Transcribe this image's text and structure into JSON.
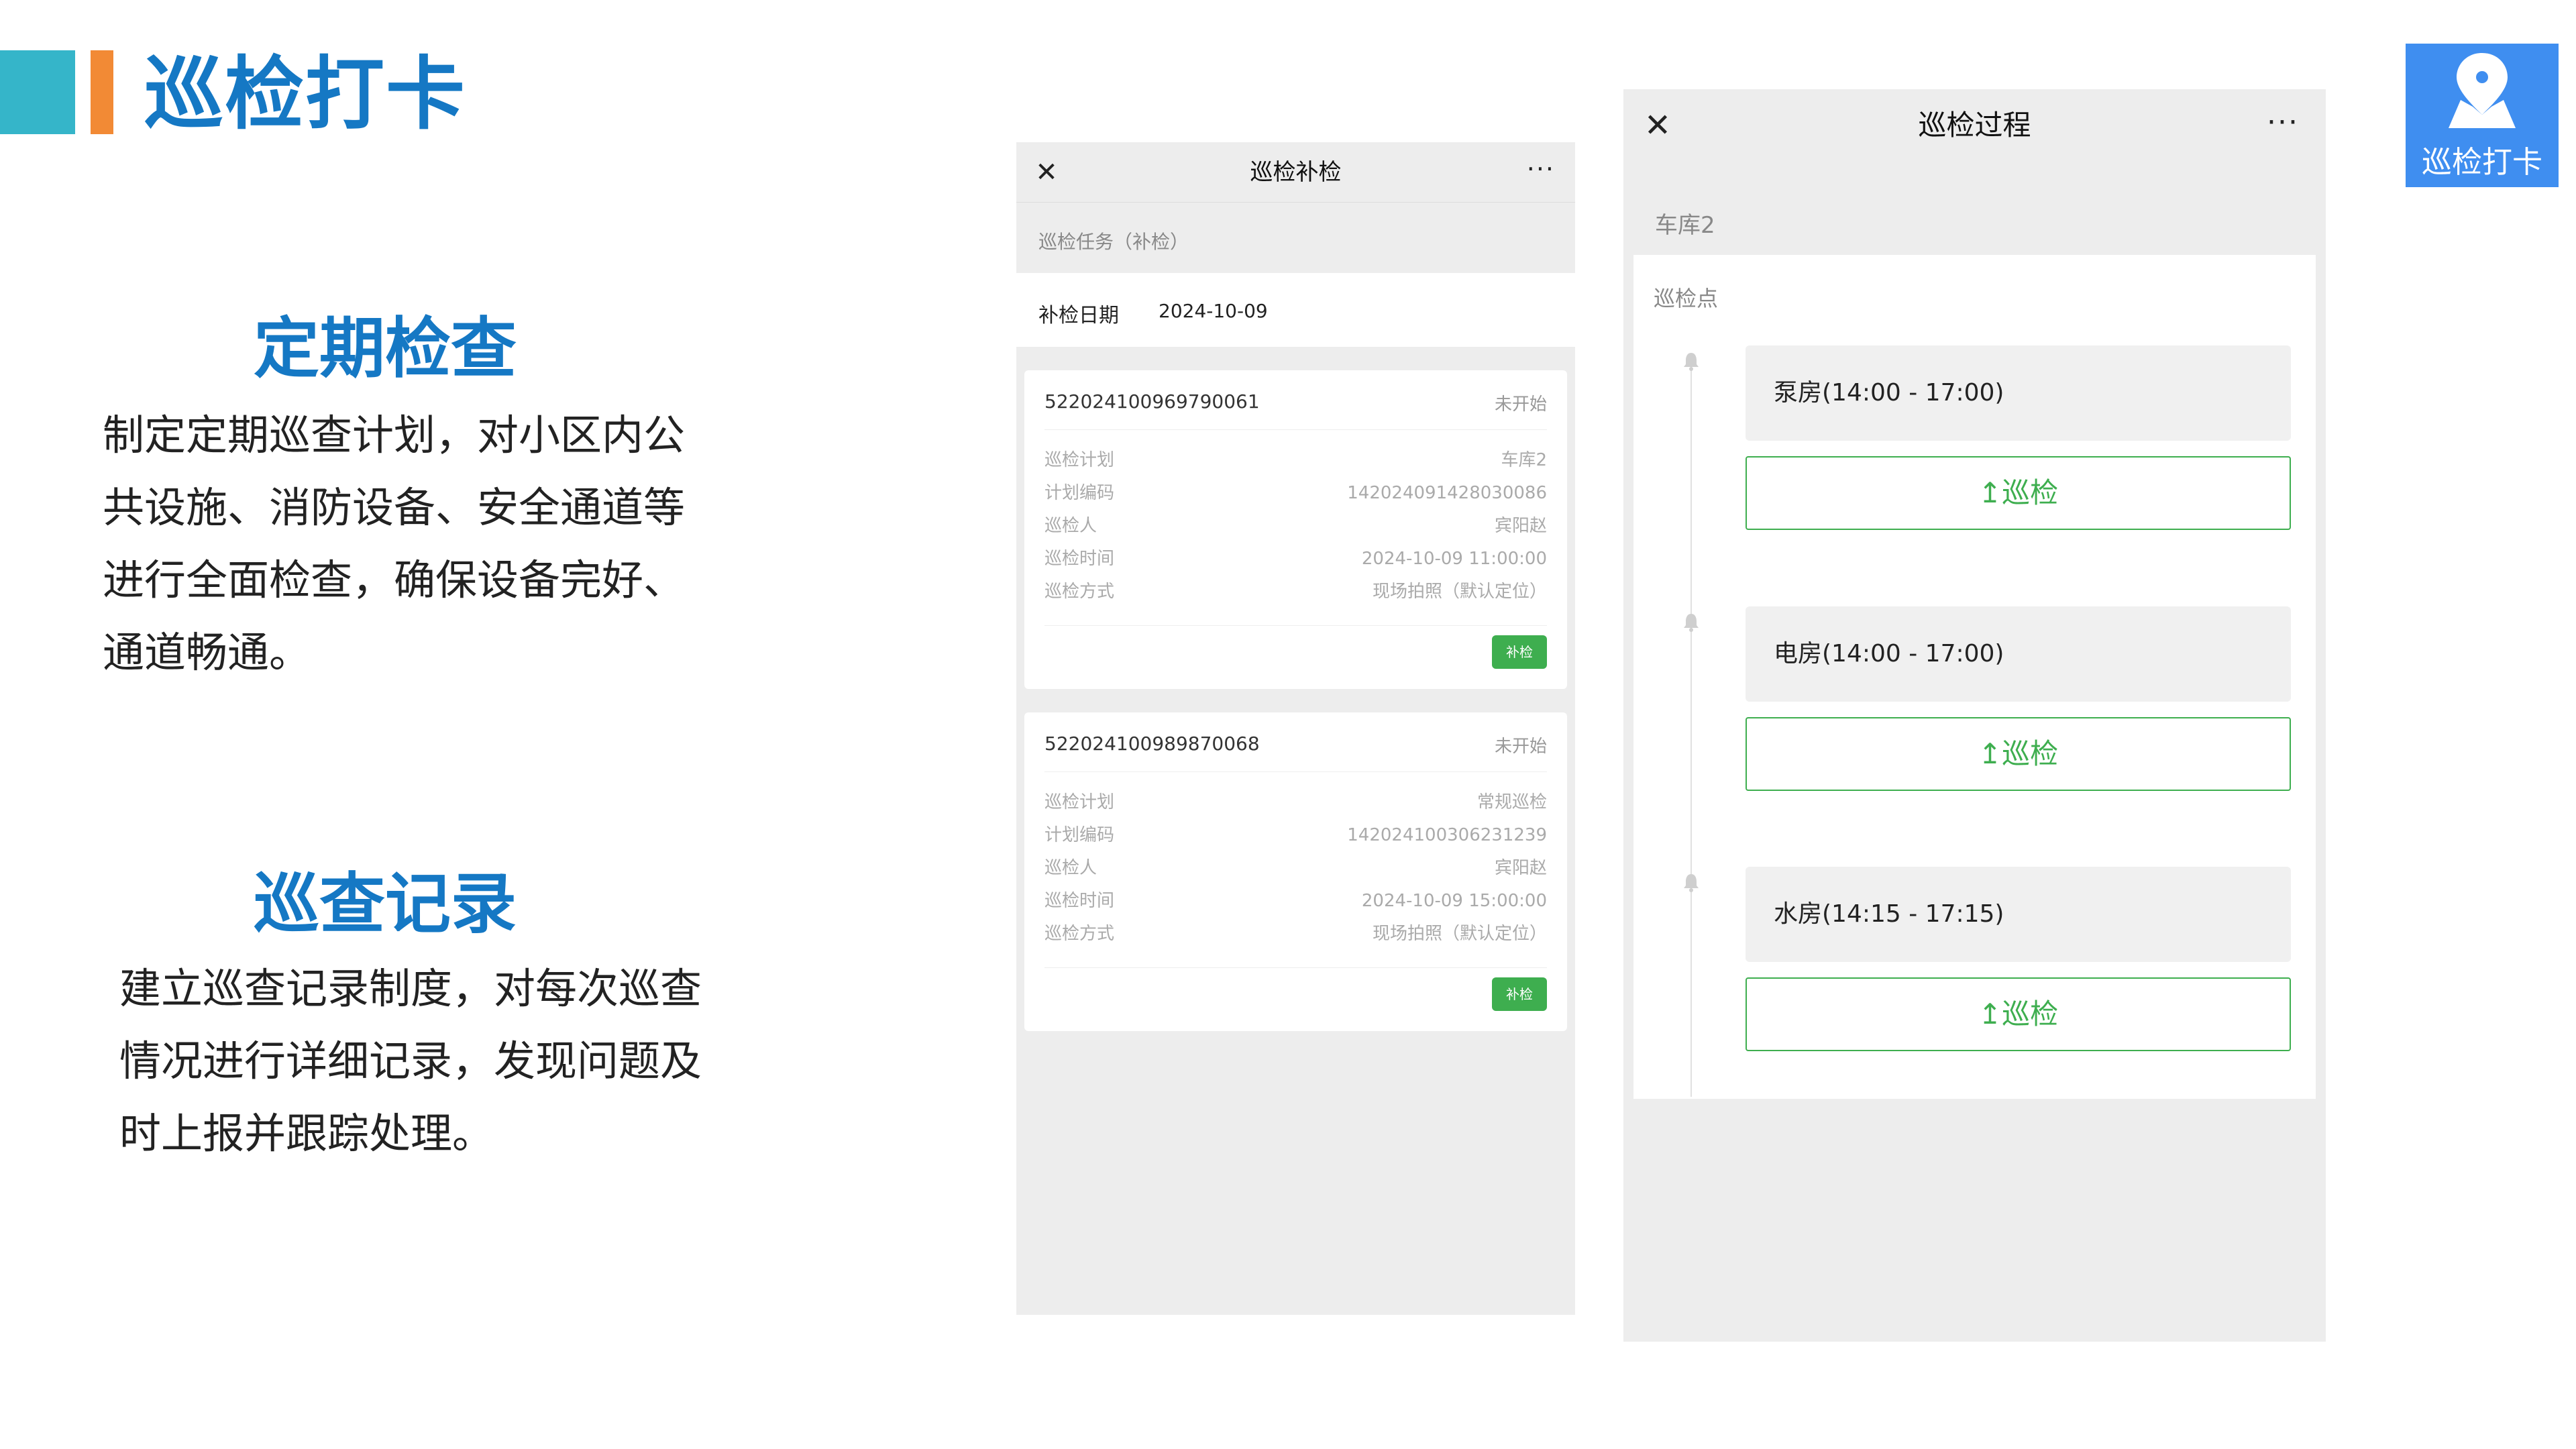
{
  "header": {
    "title": "巡检打卡"
  },
  "badge": {
    "label": "巡检打卡",
    "icon": "map-pin-icon"
  },
  "sections": [
    {
      "heading": "定期检查",
      "text": "制定定期巡查计划，对小区内公共设施、消防设备、安全通道等进行全面检查，确保设备完好、通道畅通。"
    },
    {
      "heading": "巡查记录",
      "text": "建立巡查记录制度，对每次巡查情况进行详细记录，发现问题及时上报并跟踪处理。"
    }
  ],
  "phone1": {
    "close": "✕",
    "title": "巡检补检",
    "more": "···",
    "task_label": "巡检任务（补检）",
    "date_label": "补检日期",
    "date_value": "2024-10-09",
    "cards": [
      {
        "id": "522024100969790061",
        "status": "未开始",
        "fields": [
          {
            "label": "巡检计划",
            "value": "车库2"
          },
          {
            "label": "计划编码",
            "value": "142024091428030086"
          },
          {
            "label": "巡检人",
            "value": "宾阳赵"
          },
          {
            "label": "巡检时间",
            "value": "2024-10-09 11:00:00"
          },
          {
            "label": "巡检方式",
            "value": "现场拍照（默认定位）"
          }
        ],
        "button": "补检"
      },
      {
        "id": "522024100989870068",
        "status": "未开始",
        "fields": [
          {
            "label": "巡检计划",
            "value": "常规巡检"
          },
          {
            "label": "计划编码",
            "value": "142024100306231239"
          },
          {
            "label": "巡检人",
            "value": "宾阳赵"
          },
          {
            "label": "巡检时间",
            "value": "2024-10-09 15:00:00"
          },
          {
            "label": "巡检方式",
            "value": "现场拍照（默认定位）"
          }
        ],
        "button": "补检"
      }
    ]
  },
  "phone2": {
    "close": "✕",
    "title": "巡检过程",
    "more": "···",
    "location": "车库2",
    "points_label": "巡检点",
    "points": [
      {
        "name": "泵房(14:00 - 17:00)",
        "button": "↥巡检"
      },
      {
        "name": "电房(14:00 - 17:00)",
        "button": "↥巡检"
      },
      {
        "name": "水房(14:15 - 17:15)",
        "button": "↥巡检"
      }
    ],
    "colors": {
      "accent_green": "#3eae4f"
    }
  },
  "colors": {
    "title_blue": "#1578c4",
    "bar_teal": "#35b5c9",
    "bar_orange": "#f28a35",
    "badge_blue": "#3f8ef0"
  }
}
